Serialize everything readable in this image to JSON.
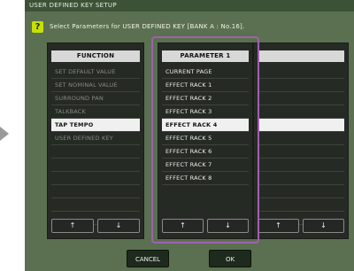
{
  "dialog": {
    "title": "USER DEFINED KEY SETUP",
    "help_glyph": "?",
    "instruction": "Select Parameters for USER DEFINED KEY [BANK A : No.16]."
  },
  "function_column": {
    "header": "FUNCTION",
    "items": [
      {
        "label": "SET DEFAULT VALUE"
      },
      {
        "label": "SET NOMINAL VALUE"
      },
      {
        "label": "SURROUND PAN"
      },
      {
        "label": "TALKBACK"
      },
      {
        "label": "TAP TEMPO",
        "selected": true
      },
      {
        "label": "USER DEFINED KEY"
      },
      {
        "label": ""
      },
      {
        "label": ""
      },
      {
        "label": ""
      },
      {
        "label": ""
      },
      {
        "label": ""
      },
      {
        "label": ""
      }
    ]
  },
  "parameter1_column": {
    "header": "PARAMETER 1",
    "items": [
      {
        "label": "CURRENT PAGE"
      },
      {
        "label": "EFFECT RACK 1"
      },
      {
        "label": "EFFECT RACK 2"
      },
      {
        "label": "EFFECT RACK 3"
      },
      {
        "label": "EFFECT RACK 4",
        "selected": true
      },
      {
        "label": "EFFECT RACK 5"
      },
      {
        "label": "EFFECT RACK 6"
      },
      {
        "label": "EFFECT RACK 7"
      },
      {
        "label": "EFFECT RACK 8"
      }
    ]
  },
  "parameter2_column": {
    "header": "",
    "items": [
      {
        "label": ""
      },
      {
        "label": ""
      },
      {
        "label": ""
      },
      {
        "label": ""
      },
      {
        "label": "",
        "selected": true
      },
      {
        "label": ""
      },
      {
        "label": ""
      },
      {
        "label": ""
      },
      {
        "label": ""
      },
      {
        "label": ""
      },
      {
        "label": ""
      },
      {
        "label": ""
      }
    ]
  },
  "scroll": {
    "up": "↑",
    "down": "↓"
  },
  "buttons": {
    "cancel": "CANCEL",
    "ok": "OK"
  },
  "colors": {
    "dialog_bg": "#5a7050",
    "panel_bg": "#262a24",
    "selected_row": "#f0f0f0",
    "highlight_border": "#a060b0",
    "help_icon": "#c8e000"
  }
}
